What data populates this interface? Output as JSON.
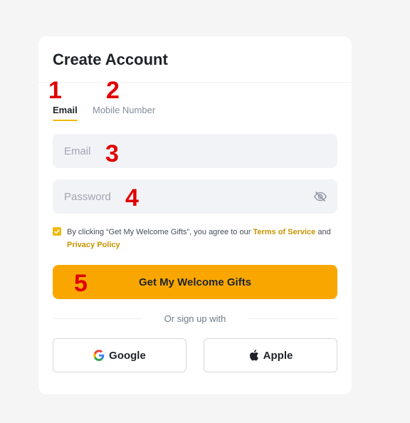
{
  "form": {
    "title": "Create Account",
    "tabs": [
      {
        "label": "Email",
        "active": true
      },
      {
        "label": "Mobile Number",
        "active": false
      }
    ],
    "email_placeholder": "Email",
    "password_placeholder": "Password",
    "agreement": {
      "prefix": "By clicking “Get My Welcome Gifts”, you agree to our ",
      "terms_link": "Terms of Service",
      "middle": " and ",
      "privacy_link": "Privacy Policy",
      "checked": true
    },
    "submit_label": "Get My Welcome Gifts",
    "divider_text": "Or sign up with",
    "social": {
      "google_label": "Google",
      "apple_label": "Apple"
    }
  },
  "markers": [
    "1",
    "2",
    "3",
    "4",
    "5"
  ],
  "colors": {
    "accent": "#f9a700",
    "link": "#c99400",
    "marker": "#e00000",
    "field_bg": "#f2f3f7"
  }
}
